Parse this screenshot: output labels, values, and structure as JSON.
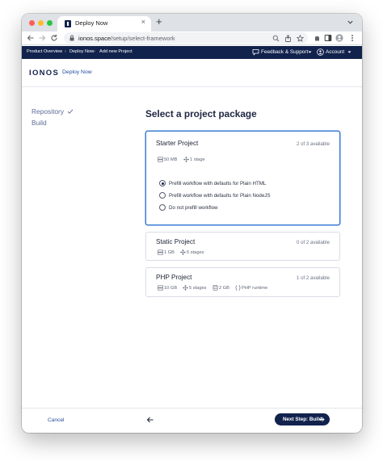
{
  "browser": {
    "tab_title": "Deploy Now",
    "tab_close": "×",
    "new_tab": "+",
    "url_host": "ionos.space",
    "url_path": "/setup/select-framework"
  },
  "appbar": {
    "breadcrumbs": [
      "Product Overview",
      "Deploy Now",
      "Add new Project"
    ],
    "separator": "›",
    "feedback_label": "Feedback & Support",
    "account_label": "Account"
  },
  "brand": {
    "logo": "IONOS",
    "product": "Deploy Now"
  },
  "steps": {
    "repository": "Repository",
    "build": "Build"
  },
  "main": {
    "title": "Select a project package",
    "packages": [
      {
        "name": "Starter Project",
        "availability": "2 of 3 available",
        "specs": [
          "50 MB",
          "1 stage"
        ],
        "options": [
          {
            "label": "Prefill workflow with defaults for Plain HTML",
            "selected": true
          },
          {
            "label": "Prefill workflow with defaults for Plain NodeJS",
            "selected": false
          },
          {
            "label": "Do not prefill workflow",
            "selected": false
          }
        ]
      },
      {
        "name": "Static Project",
        "availability": "0 of 2 available",
        "specs": [
          "1 GB",
          "5 stages"
        ]
      },
      {
        "name": "PHP Project",
        "availability": "1 of 2 available",
        "specs": [
          "10 GB",
          "5 stages",
          "2 GB",
          "PHP runtime"
        ]
      }
    ]
  },
  "footer": {
    "cancel_label": "Cancel",
    "next_label": "Next Step: Build"
  },
  "colors": {
    "brand_navy": "#11224d",
    "link_blue": "#1f4a9e",
    "selected_border": "#3a7bd5"
  }
}
